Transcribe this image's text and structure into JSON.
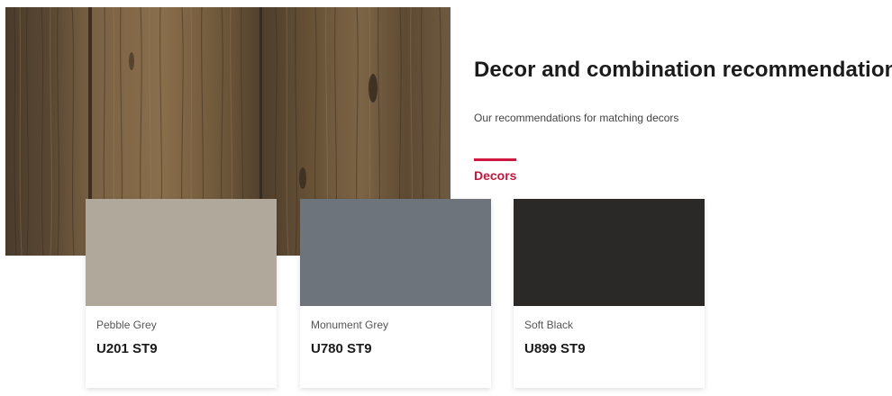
{
  "hero": {
    "image": "wood-texture-image"
  },
  "section": {
    "title": "Decor and combination recommendations",
    "subtitle": "Our recommendations for matching decors",
    "tab_label": "Decors",
    "accent_color": "#d0173f"
  },
  "cards": [
    {
      "name": "Pebble Grey",
      "code": "U201 ST9",
      "color": "#b0a89b"
    },
    {
      "name": "Monument Grey",
      "code": "U780 ST9",
      "color": "#6d747b"
    },
    {
      "name": "Soft Black",
      "code": "U899 ST9",
      "color": "#2b2928"
    }
  ]
}
